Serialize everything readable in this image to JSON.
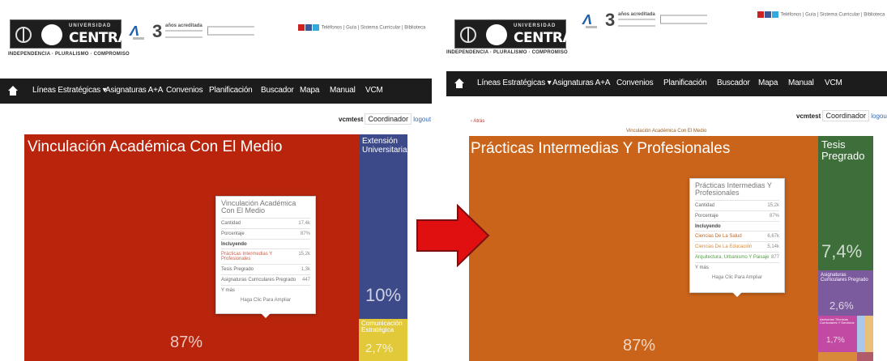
{
  "colors": {
    "red": "#b8250c",
    "navy": "#3c4a8a",
    "yellow": "#e2c93a",
    "orange": "#c9641a",
    "green": "#3e6e3a",
    "purple": "#7b5a9e",
    "pink": "#c24aa3",
    "navbar": "#1c1c1c",
    "arrow": "#e01010",
    "link": "#3a6ab0"
  },
  "header": {
    "logo_top": "UNIVERSIDAD",
    "logo_name": "CENTRAL",
    "motto": "INDEPENDENCIA · PLURALISMO · COMPROMISO",
    "accred_years": "3",
    "accred_label": "años acreditada",
    "social_links": "Teléfonos | Guía | Sistema Curricular | Biblioteca"
  },
  "nav": {
    "items": [
      "Líneas Estratégicas",
      "Asignaturas A+A",
      "Convenios",
      "Planificación",
      "Buscador",
      "Mapa",
      "Manual",
      "VCM"
    ]
  },
  "user": {
    "username": "vcmtest",
    "role": "Coordinador",
    "logout": "logout"
  },
  "left": {
    "tiles": {
      "main": {
        "label": "Vinculación Académica Con El Medio",
        "pct": "87%"
      },
      "extension": {
        "label": "Extensión Universitaria",
        "pct": "10%"
      },
      "comunicacion": {
        "label": "Comunicación Estratégica",
        "pct": "2,7%"
      }
    },
    "tooltip": {
      "title": "Vinculación Académica Con El Medio",
      "cantidad_label": "Cantidad",
      "cantidad": "17,4k",
      "porcentaje_label": "Porcentaje",
      "porcentaje": "87%",
      "incluyendo": "Incluyendo",
      "items": [
        {
          "label": "Prácticas Intermedias Y Profesionales",
          "value": "15,2k"
        },
        {
          "label": "Tesis Pregrado",
          "value": "1,3k"
        },
        {
          "label": "Asignaturas Curriculares Pregrado",
          "value": "447"
        },
        {
          "label": "Y más",
          "value": ""
        }
      ],
      "hint": "Haga Clic Para Ampliar"
    }
  },
  "right": {
    "back": "‹ Atrás",
    "breadcrumb": "Vinculación Académica Con El Medio",
    "tiles": {
      "main": {
        "label": "Prácticas Intermedias Y Profesionales",
        "pct": "87%"
      },
      "tesis": {
        "label": "Tesis Pregrado",
        "pct": "7,4%"
      },
      "asignaturas": {
        "label": "Asignaturas Curriculares Pregrado",
        "pct": "2,6%"
      },
      "small": {
        "label": "Asesorías Técnicas Curriculares Y Servicios",
        "pct": "1,7%"
      }
    },
    "tooltip": {
      "title": "Prácticas Intermedias Y Profesionales",
      "cantidad_label": "Cantidad",
      "cantidad": "15,2k",
      "porcentaje_label": "Porcentaje",
      "porcentaje": "87%",
      "incluyendo": "Incluyendo",
      "items": [
        {
          "label": "Ciencias De La Salud",
          "value": "6,67k"
        },
        {
          "label": "Ciencias De La Educación",
          "value": "5,14k"
        },
        {
          "label": "Arquitectura, Urbanismo Y Paisaje",
          "value": "877"
        },
        {
          "label": "Y más",
          "value": ""
        }
      ],
      "hint": "Haga Clic Para Ampliar"
    }
  }
}
